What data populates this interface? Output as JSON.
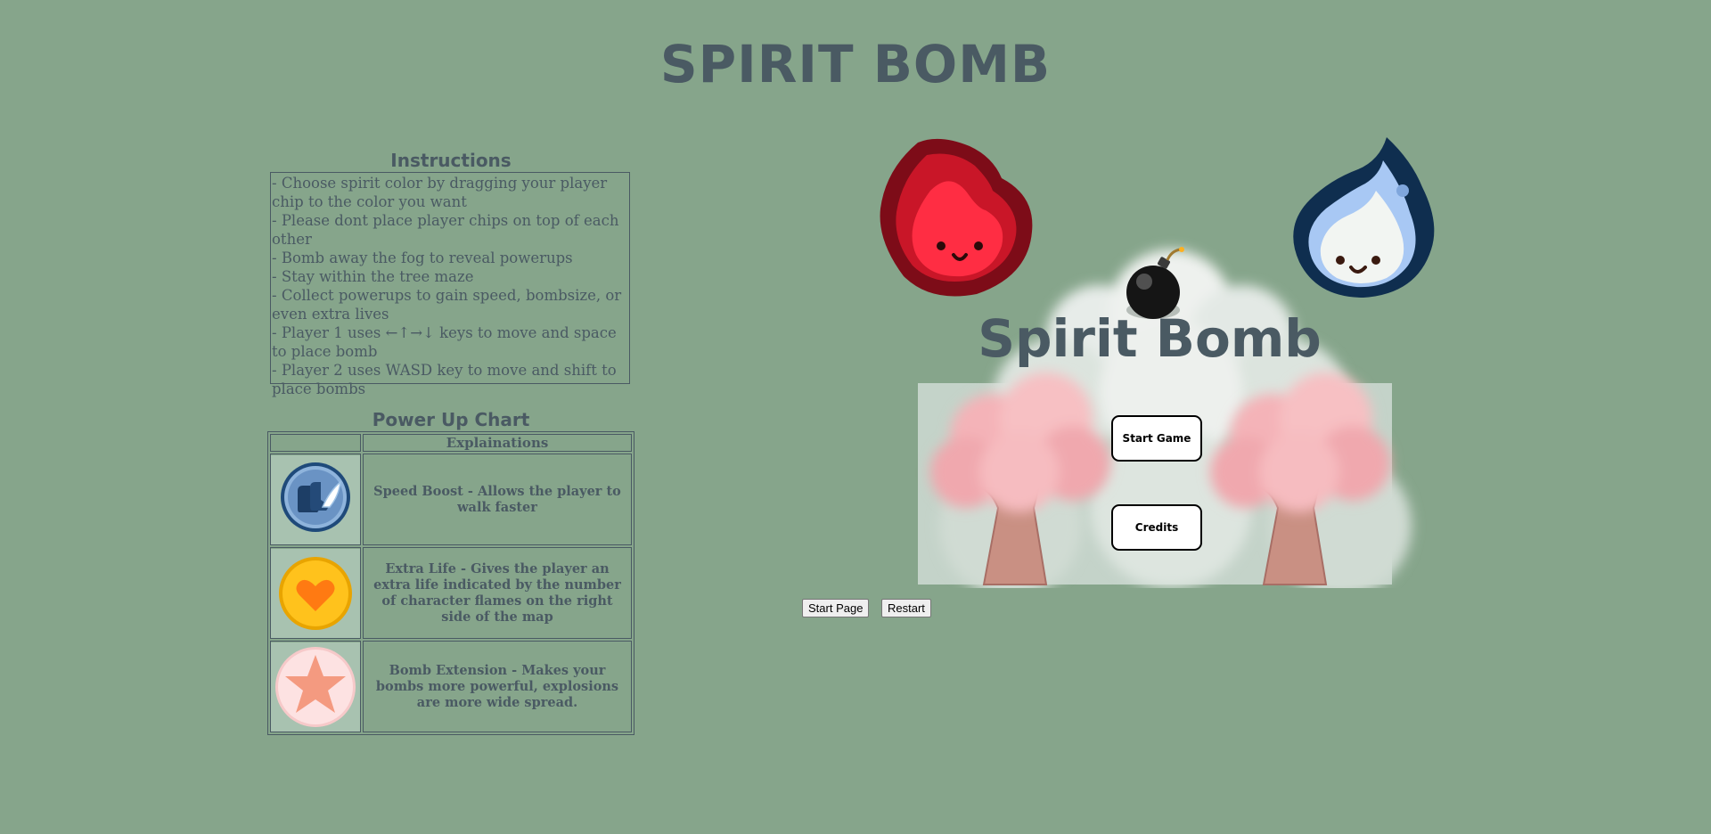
{
  "page": {
    "title": "SPIRIT BOMB"
  },
  "instructions": {
    "title": "Instructions",
    "lines": [
      "- Choose spirit color by dragging your player chip to the color you want",
      "- Please dont place player chips on top of each other",
      "- Bomb away the fog to reveal powerups",
      "- Stay within the tree maze",
      "- Collect powerups to gain speed, bombsize, or even extra lives",
      "- Player 1 uses ←↑→↓ keys to move and space to place bomb",
      "- Player 2 uses WASD key to move and shift to place bombs"
    ]
  },
  "powerups": {
    "title": "Power Up Chart",
    "header": "Explainations",
    "rows": [
      {
        "icon": "speed-boost-icon",
        "desc": "Speed Boost - Allows the player to walk faster"
      },
      {
        "icon": "extra-life-icon",
        "desc": "Extra Life - Gives the player an extra life indicated by the number of character flames on the right side of the map"
      },
      {
        "icon": "bomb-extension-icon",
        "desc": "Bomb Extension - Makes your bombs more powerful, explosions are more wide spread."
      }
    ]
  },
  "game": {
    "logo": "Spirit Bomb",
    "start_game": "Start Game",
    "credits": "Credits",
    "red_spirit_icon": "red-spirit-icon",
    "blue_spirit_icon": "blue-spirit-icon",
    "bomb_icon": "bomb-icon",
    "tree_icon": "cherry-tree-icon"
  },
  "controls": {
    "start_page": "Start Page",
    "restart": "Restart"
  },
  "colors": {
    "background": "#86a58b",
    "text": "#4a5a63",
    "red_spirit": "#ff2d43",
    "blue_spirit": "#0f2e4f"
  }
}
